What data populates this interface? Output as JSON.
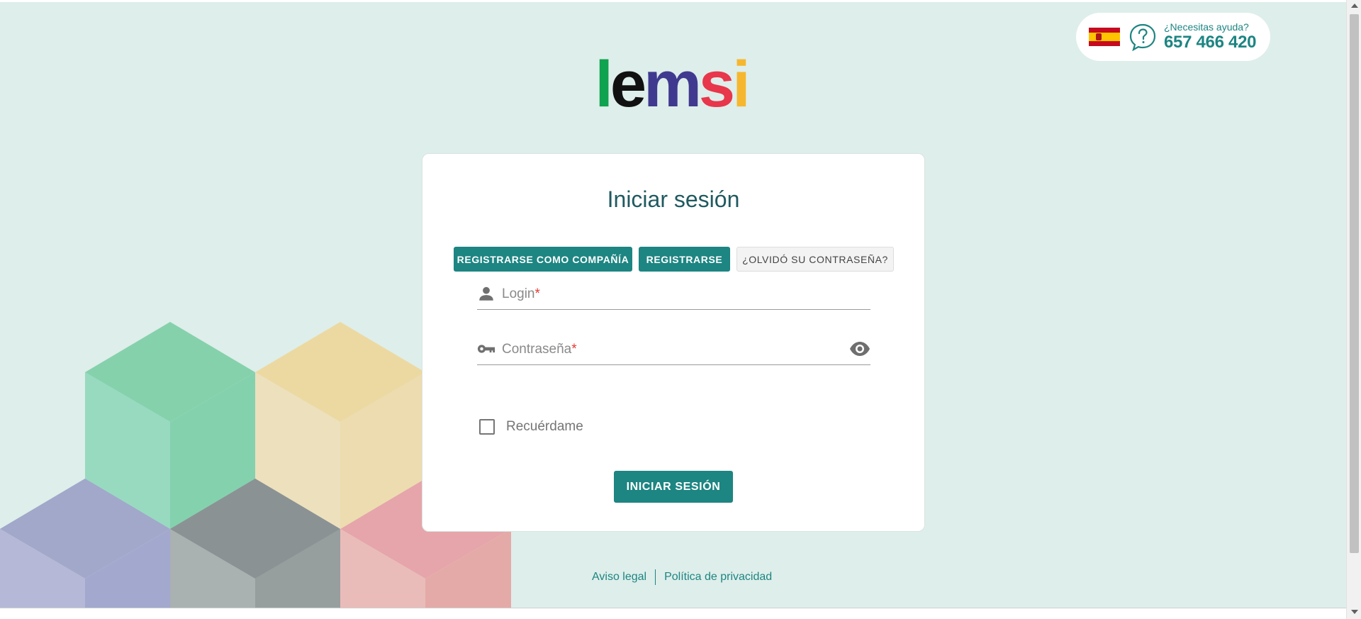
{
  "colors": {
    "background": "#deeeea",
    "primary": "#1d8582",
    "title": "#205a60",
    "required": "#e53935"
  },
  "help": {
    "question": "¿Necesitas ayuda?",
    "phone": "657 466 420",
    "flag_icon": "spain-flag-icon",
    "help_icon": "question-bubble-icon"
  },
  "logo": {
    "letters": [
      {
        "char": "l",
        "color": "#0fa24f"
      },
      {
        "char": "e",
        "color": "#111111"
      },
      {
        "char": "m",
        "color": "#3f3a8f"
      },
      {
        "char": "s",
        "color": "#e8364b"
      },
      {
        "char": "i",
        "color": "#f6b72e"
      }
    ]
  },
  "login": {
    "title": "Iniciar sesión",
    "buttons": {
      "register_company": "Registrarse como compañía",
      "register": "Registrarse",
      "forgot_password": "¿Olvidó su contraseña?"
    },
    "fields": {
      "login_label": "Login",
      "password_label": "Contraseña",
      "required_mark": "*"
    },
    "remember_label": "Recuérdame",
    "submit_label": "Iniciar sesión"
  },
  "footer": {
    "legal": "Aviso legal",
    "privacy": "Política de privacidad"
  }
}
